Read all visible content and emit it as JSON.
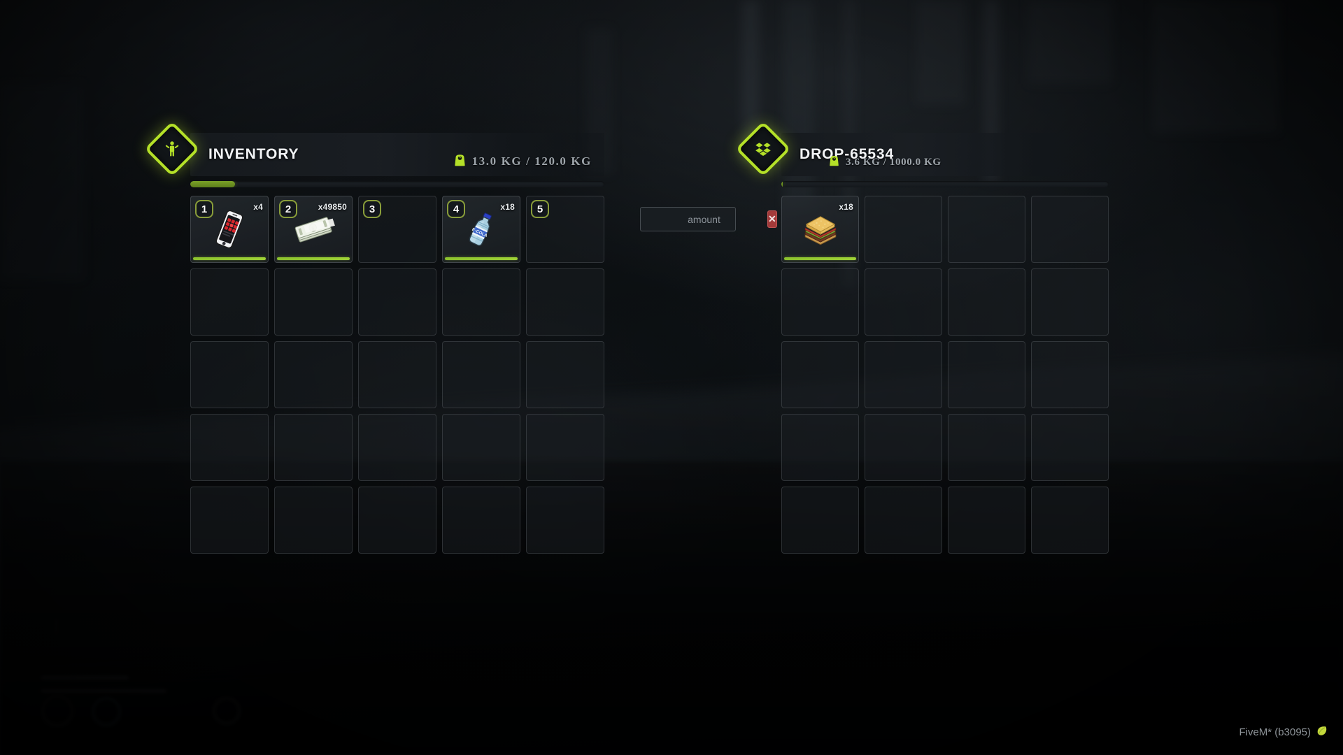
{
  "app": {
    "watermark_label": "FiveM* (b3095)",
    "watermark_icon": "fivem-leaf-icon"
  },
  "accent": {
    "green": "#b4e028",
    "bar_green": "#8cc22e",
    "badge_border": "#8a9e3a",
    "danger_red": "#a33a3a"
  },
  "amount_field": {
    "name": "amount-input",
    "value": "",
    "placeholder": "amount",
    "clear_label": "✕"
  },
  "inventory": {
    "title": "INVENTORY",
    "icon": "player-diamond-icon",
    "weight_icon": "scale-icon",
    "weight_text": "13.0 KG / 120.0 KG",
    "weight_current": 13.0,
    "weight_max": 120.0,
    "weight_percent": 10.8,
    "columns": 5,
    "rows": 5,
    "slots": [
      {
        "number": "1",
        "item": "phone",
        "icon": "phone-icon",
        "count": "x4",
        "durability": 100,
        "empty": false
      },
      {
        "number": "2",
        "item": "money",
        "icon": "money-icon",
        "count": "x49850",
        "durability": 100,
        "empty": false
      },
      {
        "number": "3",
        "item": "",
        "icon": "",
        "count": "",
        "durability": 0,
        "empty": true
      },
      {
        "number": "4",
        "item": "water_bottle",
        "icon": "water-icon",
        "count": "x18",
        "durability": 100,
        "empty": false
      },
      {
        "number": "5",
        "item": "",
        "icon": "",
        "count": "",
        "durability": 0,
        "empty": true
      },
      {
        "number": "",
        "item": "",
        "icon": "",
        "count": "",
        "durability": 0,
        "empty": true
      },
      {
        "number": "",
        "item": "",
        "icon": "",
        "count": "",
        "durability": 0,
        "empty": true
      },
      {
        "number": "",
        "item": "",
        "icon": "",
        "count": "",
        "durability": 0,
        "empty": true
      },
      {
        "number": "",
        "item": "",
        "icon": "",
        "count": "",
        "durability": 0,
        "empty": true
      },
      {
        "number": "",
        "item": "",
        "icon": "",
        "count": "",
        "durability": 0,
        "empty": true
      },
      {
        "number": "",
        "item": "",
        "icon": "",
        "count": "",
        "durability": 0,
        "empty": true
      },
      {
        "number": "",
        "item": "",
        "icon": "",
        "count": "",
        "durability": 0,
        "empty": true
      },
      {
        "number": "",
        "item": "",
        "icon": "",
        "count": "",
        "durability": 0,
        "empty": true
      },
      {
        "number": "",
        "item": "",
        "icon": "",
        "count": "",
        "durability": 0,
        "empty": true
      },
      {
        "number": "",
        "item": "",
        "icon": "",
        "count": "",
        "durability": 0,
        "empty": true
      },
      {
        "number": "",
        "item": "",
        "icon": "",
        "count": "",
        "durability": 0,
        "empty": true
      },
      {
        "number": "",
        "item": "",
        "icon": "",
        "count": "",
        "durability": 0,
        "empty": true
      },
      {
        "number": "",
        "item": "",
        "icon": "",
        "count": "",
        "durability": 0,
        "empty": true
      },
      {
        "number": "",
        "item": "",
        "icon": "",
        "count": "",
        "durability": 0,
        "empty": true
      },
      {
        "number": "",
        "item": "",
        "icon": "",
        "count": "",
        "durability": 0,
        "empty": true
      },
      {
        "number": "",
        "item": "",
        "icon": "",
        "count": "",
        "durability": 0,
        "empty": true
      },
      {
        "number": "",
        "item": "",
        "icon": "",
        "count": "",
        "durability": 0,
        "empty": true
      },
      {
        "number": "",
        "item": "",
        "icon": "",
        "count": "",
        "durability": 0,
        "empty": true
      },
      {
        "number": "",
        "item": "",
        "icon": "",
        "count": "",
        "durability": 0,
        "empty": true
      },
      {
        "number": "",
        "item": "",
        "icon": "",
        "count": "",
        "durability": 0,
        "empty": true
      }
    ]
  },
  "drop": {
    "title": "DROP-65534",
    "icon": "dropbox-diamond-icon",
    "weight_icon": "scale-icon",
    "weight_text": "3.6 KG / 1000.0 KG",
    "weight_current": 3.6,
    "weight_max": 1000.0,
    "weight_percent": 0.36,
    "columns": 4,
    "rows": 5,
    "slots": [
      {
        "number": "",
        "item": "sandwich",
        "icon": "sandwich-icon",
        "count": "x18",
        "durability": 100,
        "empty": false
      },
      {
        "number": "",
        "item": "",
        "icon": "",
        "count": "",
        "durability": 0,
        "empty": true
      },
      {
        "number": "",
        "item": "",
        "icon": "",
        "count": "",
        "durability": 0,
        "empty": true
      },
      {
        "number": "",
        "item": "",
        "icon": "",
        "count": "",
        "durability": 0,
        "empty": true
      },
      {
        "number": "",
        "item": "",
        "icon": "",
        "count": "",
        "durability": 0,
        "empty": true
      },
      {
        "number": "",
        "item": "",
        "icon": "",
        "count": "",
        "durability": 0,
        "empty": true
      },
      {
        "number": "",
        "item": "",
        "icon": "",
        "count": "",
        "durability": 0,
        "empty": true
      },
      {
        "number": "",
        "item": "",
        "icon": "",
        "count": "",
        "durability": 0,
        "empty": true
      },
      {
        "number": "",
        "item": "",
        "icon": "",
        "count": "",
        "durability": 0,
        "empty": true
      },
      {
        "number": "",
        "item": "",
        "icon": "",
        "count": "",
        "durability": 0,
        "empty": true
      },
      {
        "number": "",
        "item": "",
        "icon": "",
        "count": "",
        "durability": 0,
        "empty": true
      },
      {
        "number": "",
        "item": "",
        "icon": "",
        "count": "",
        "durability": 0,
        "empty": true
      },
      {
        "number": "",
        "item": "",
        "icon": "",
        "count": "",
        "durability": 0,
        "empty": true
      },
      {
        "number": "",
        "item": "",
        "icon": "",
        "count": "",
        "durability": 0,
        "empty": true
      },
      {
        "number": "",
        "item": "",
        "icon": "",
        "count": "",
        "durability": 0,
        "empty": true
      },
      {
        "number": "",
        "item": "",
        "icon": "",
        "count": "",
        "durability": 0,
        "empty": true
      },
      {
        "number": "",
        "item": "",
        "icon": "",
        "count": "",
        "durability": 0,
        "empty": true
      },
      {
        "number": "",
        "item": "",
        "icon": "",
        "count": "",
        "durability": 0,
        "empty": true
      },
      {
        "number": "",
        "item": "",
        "icon": "",
        "count": "",
        "durability": 0,
        "empty": true
      },
      {
        "number": "",
        "item": "",
        "icon": "",
        "count": "",
        "durability": 0,
        "empty": true
      }
    ]
  }
}
